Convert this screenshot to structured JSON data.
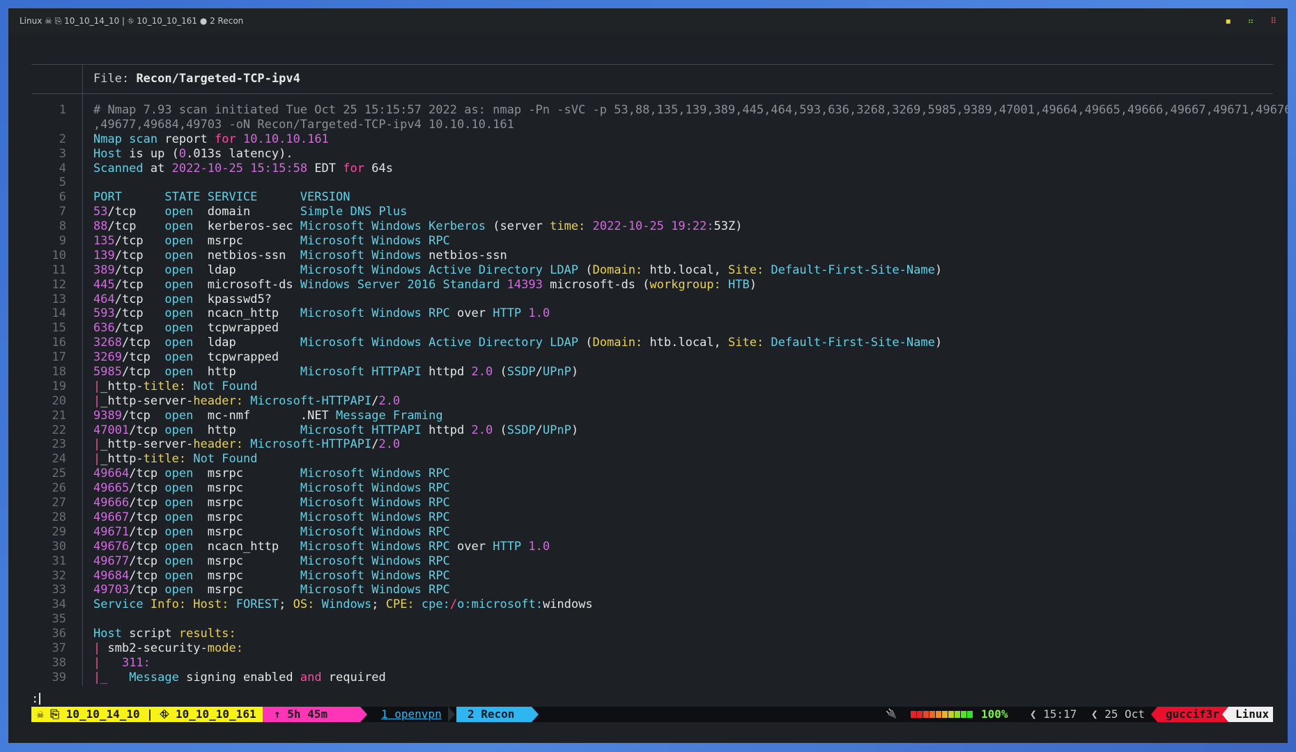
{
  "titlebar": {
    "text": "Linux ☠ ⎘ 10_10_14_10 | ⛗ 10_10_10_161 ● 2 Recon",
    "controls": [
      "▪",
      "⠶",
      "⠿"
    ]
  },
  "file_header": {
    "label": "File:",
    "filename": "Recon/Targeted-TCP-ipv4"
  },
  "lines": [
    {
      "n": "1",
      "segs": [
        [
          "cm",
          "# Nmap 7.93 scan initiated Tue Oct 25 15:15:57 2022 as: nmap -Pn -sVC -p 53,88,135,139,389,445,464,593,636,3268,3269,5985,9389,47001,49664,49665,49666,49667,49671,49676"
        ]
      ]
    },
    {
      "n": "",
      "segs": [
        [
          "cm",
          ",49677,49684,49703 -oN Recon/Targeted-TCP-ipv4 10.10.10.161"
        ]
      ]
    },
    {
      "n": "2",
      "segs": [
        [
          "k",
          "Nmap scan "
        ],
        [
          "w",
          "report "
        ],
        [
          "pk",
          "for "
        ],
        [
          "p",
          "10.10.10.161"
        ]
      ]
    },
    {
      "n": "3",
      "segs": [
        [
          "k",
          "Host "
        ],
        [
          "w",
          "is up ("
        ],
        [
          "p",
          "0"
        ],
        [
          "w",
          ".013s latency)."
        ]
      ]
    },
    {
      "n": "4",
      "segs": [
        [
          "k",
          "Scanned "
        ],
        [
          "w",
          "at "
        ],
        [
          "p",
          "2022-10-25 15:15:58 "
        ],
        [
          "w",
          "EDT "
        ],
        [
          "pk",
          "for "
        ],
        [
          "w",
          "64s"
        ]
      ]
    },
    {
      "n": "5",
      "segs": []
    },
    {
      "n": "6",
      "segs": [
        [
          "k",
          "PORT      STATE SERVICE      VERSION"
        ]
      ]
    },
    {
      "n": "7",
      "segs": [
        [
          "p",
          "53"
        ],
        [
          "w",
          "/tcp    "
        ],
        [
          "k",
          "open  "
        ],
        [
          "w",
          "domain       "
        ],
        [
          "k",
          "Simple DNS Plus"
        ]
      ]
    },
    {
      "n": "8",
      "segs": [
        [
          "p",
          "88"
        ],
        [
          "w",
          "/tcp    "
        ],
        [
          "k",
          "open  "
        ],
        [
          "w",
          "kerberos-sec "
        ],
        [
          "k",
          "Microsoft Windows Kerberos "
        ],
        [
          "w",
          "(server "
        ],
        [
          "y",
          "time: "
        ],
        [
          "p",
          "2022-10-25 19:22:"
        ],
        [
          "w",
          "53Z)"
        ]
      ]
    },
    {
      "n": "9",
      "segs": [
        [
          "p",
          "135"
        ],
        [
          "w",
          "/tcp   "
        ],
        [
          "k",
          "open  "
        ],
        [
          "w",
          "msrpc        "
        ],
        [
          "k",
          "Microsoft Windows RPC"
        ]
      ]
    },
    {
      "n": "10",
      "segs": [
        [
          "p",
          "139"
        ],
        [
          "w",
          "/tcp   "
        ],
        [
          "k",
          "open  "
        ],
        [
          "w",
          "netbios-ssn  "
        ],
        [
          "k",
          "Microsoft Windows "
        ],
        [
          "w",
          "netbios-ssn"
        ]
      ]
    },
    {
      "n": "11",
      "segs": [
        [
          "p",
          "389"
        ],
        [
          "w",
          "/tcp   "
        ],
        [
          "k",
          "open  "
        ],
        [
          "w",
          "ldap         "
        ],
        [
          "k",
          "Microsoft Windows Active Directory LDAP "
        ],
        [
          "w",
          "("
        ],
        [
          "y",
          "Domain: "
        ],
        [
          "w",
          "htb.local, "
        ],
        [
          "y",
          "Site: "
        ],
        [
          "k",
          "Default-First-Site-Name"
        ],
        [
          "w",
          ")"
        ]
      ]
    },
    {
      "n": "12",
      "segs": [
        [
          "p",
          "445"
        ],
        [
          "w",
          "/tcp   "
        ],
        [
          "k",
          "open  "
        ],
        [
          "w",
          "microsoft-ds "
        ],
        [
          "k",
          "Windows Server 2016 Standard "
        ],
        [
          "p",
          "14393 "
        ],
        [
          "w",
          "microsoft-ds ("
        ],
        [
          "y",
          "workgroup: "
        ],
        [
          "k",
          "HTB"
        ],
        [
          "w",
          ")"
        ]
      ]
    },
    {
      "n": "13",
      "segs": [
        [
          "p",
          "464"
        ],
        [
          "w",
          "/tcp   "
        ],
        [
          "k",
          "open  "
        ],
        [
          "w",
          "kpasswd5?"
        ]
      ]
    },
    {
      "n": "14",
      "segs": [
        [
          "p",
          "593"
        ],
        [
          "w",
          "/tcp   "
        ],
        [
          "k",
          "open  "
        ],
        [
          "w",
          "ncacn_http   "
        ],
        [
          "k",
          "Microsoft Windows RPC "
        ],
        [
          "w",
          "over "
        ],
        [
          "k",
          "HTTP "
        ],
        [
          "p",
          "1.0"
        ]
      ]
    },
    {
      "n": "15",
      "segs": [
        [
          "p",
          "636"
        ],
        [
          "w",
          "/tcp   "
        ],
        [
          "k",
          "open  "
        ],
        [
          "w",
          "tcpwrapped"
        ]
      ]
    },
    {
      "n": "16",
      "segs": [
        [
          "p",
          "3268"
        ],
        [
          "w",
          "/tcp  "
        ],
        [
          "k",
          "open  "
        ],
        [
          "w",
          "ldap         "
        ],
        [
          "k",
          "Microsoft Windows Active Directory LDAP "
        ],
        [
          "w",
          "("
        ],
        [
          "y",
          "Domain: "
        ],
        [
          "w",
          "htb.local, "
        ],
        [
          "y",
          "Site: "
        ],
        [
          "k",
          "Default-First-Site-Name"
        ],
        [
          "w",
          ")"
        ]
      ]
    },
    {
      "n": "17",
      "segs": [
        [
          "p",
          "3269"
        ],
        [
          "w",
          "/tcp  "
        ],
        [
          "k",
          "open  "
        ],
        [
          "w",
          "tcpwrapped"
        ]
      ]
    },
    {
      "n": "18",
      "segs": [
        [
          "p",
          "5985"
        ],
        [
          "w",
          "/tcp  "
        ],
        [
          "k",
          "open  "
        ],
        [
          "w",
          "http         "
        ],
        [
          "k",
          "Microsoft HTTPAPI "
        ],
        [
          "w",
          "httpd "
        ],
        [
          "p",
          "2.0 "
        ],
        [
          "w",
          "("
        ],
        [
          "k",
          "SSDP"
        ],
        [
          "w",
          "/"
        ],
        [
          "k",
          "UPnP"
        ],
        [
          "w",
          ")"
        ]
      ]
    },
    {
      "n": "19",
      "segs": [
        [
          "pk",
          "|"
        ],
        [
          "w",
          "_http-"
        ],
        [
          "y",
          "title: "
        ],
        [
          "k",
          "Not Found"
        ]
      ]
    },
    {
      "n": "20",
      "segs": [
        [
          "pk",
          "|"
        ],
        [
          "w",
          "_http-server-"
        ],
        [
          "y",
          "header: "
        ],
        [
          "k",
          "Microsoft-HTTPAPI"
        ],
        [
          "w",
          "/"
        ],
        [
          "p",
          "2.0"
        ]
      ]
    },
    {
      "n": "21",
      "segs": [
        [
          "p",
          "9389"
        ],
        [
          "w",
          "/tcp  "
        ],
        [
          "k",
          "open  "
        ],
        [
          "w",
          "mc-nmf       .NET "
        ],
        [
          "k",
          "Message Framing"
        ]
      ]
    },
    {
      "n": "22",
      "segs": [
        [
          "p",
          "47001"
        ],
        [
          "w",
          "/tcp "
        ],
        [
          "k",
          "open  "
        ],
        [
          "w",
          "http         "
        ],
        [
          "k",
          "Microsoft HTTPAPI "
        ],
        [
          "w",
          "httpd "
        ],
        [
          "p",
          "2.0 "
        ],
        [
          "w",
          "("
        ],
        [
          "k",
          "SSDP"
        ],
        [
          "w",
          "/"
        ],
        [
          "k",
          "UPnP"
        ],
        [
          "w",
          ")"
        ]
      ]
    },
    {
      "n": "23",
      "segs": [
        [
          "pk",
          "|"
        ],
        [
          "w",
          "_http-server-"
        ],
        [
          "y",
          "header: "
        ],
        [
          "k",
          "Microsoft-HTTPAPI"
        ],
        [
          "w",
          "/"
        ],
        [
          "p",
          "2.0"
        ]
      ]
    },
    {
      "n": "24",
      "segs": [
        [
          "pk",
          "|"
        ],
        [
          "w",
          "_http-"
        ],
        [
          "y",
          "title: "
        ],
        [
          "k",
          "Not Found"
        ]
      ]
    },
    {
      "n": "25",
      "segs": [
        [
          "p",
          "49664"
        ],
        [
          "w",
          "/tcp "
        ],
        [
          "k",
          "open  "
        ],
        [
          "w",
          "msrpc        "
        ],
        [
          "k",
          "Microsoft Windows RPC"
        ]
      ]
    },
    {
      "n": "26",
      "segs": [
        [
          "p",
          "49665"
        ],
        [
          "w",
          "/tcp "
        ],
        [
          "k",
          "open  "
        ],
        [
          "w",
          "msrpc        "
        ],
        [
          "k",
          "Microsoft Windows RPC"
        ]
      ]
    },
    {
      "n": "27",
      "segs": [
        [
          "p",
          "49666"
        ],
        [
          "w",
          "/tcp "
        ],
        [
          "k",
          "open  "
        ],
        [
          "w",
          "msrpc        "
        ],
        [
          "k",
          "Microsoft Windows RPC"
        ]
      ]
    },
    {
      "n": "28",
      "segs": [
        [
          "p",
          "49667"
        ],
        [
          "w",
          "/tcp "
        ],
        [
          "k",
          "open  "
        ],
        [
          "w",
          "msrpc        "
        ],
        [
          "k",
          "Microsoft Windows RPC"
        ]
      ]
    },
    {
      "n": "29",
      "segs": [
        [
          "p",
          "49671"
        ],
        [
          "w",
          "/tcp "
        ],
        [
          "k",
          "open  "
        ],
        [
          "w",
          "msrpc        "
        ],
        [
          "k",
          "Microsoft Windows RPC"
        ]
      ]
    },
    {
      "n": "30",
      "segs": [
        [
          "p",
          "49676"
        ],
        [
          "w",
          "/tcp "
        ],
        [
          "k",
          "open  "
        ],
        [
          "w",
          "ncacn_http   "
        ],
        [
          "k",
          "Microsoft Windows RPC "
        ],
        [
          "w",
          "over "
        ],
        [
          "k",
          "HTTP "
        ],
        [
          "p",
          "1.0"
        ]
      ]
    },
    {
      "n": "31",
      "segs": [
        [
          "p",
          "49677"
        ],
        [
          "w",
          "/tcp "
        ],
        [
          "k",
          "open  "
        ],
        [
          "w",
          "msrpc        "
        ],
        [
          "k",
          "Microsoft Windows RPC"
        ]
      ]
    },
    {
      "n": "32",
      "segs": [
        [
          "p",
          "49684"
        ],
        [
          "w",
          "/tcp "
        ],
        [
          "k",
          "open  "
        ],
        [
          "w",
          "msrpc        "
        ],
        [
          "k",
          "Microsoft Windows RPC"
        ]
      ]
    },
    {
      "n": "33",
      "segs": [
        [
          "p",
          "49703"
        ],
        [
          "w",
          "/tcp "
        ],
        [
          "k",
          "open  "
        ],
        [
          "w",
          "msrpc        "
        ],
        [
          "k",
          "Microsoft Windows RPC"
        ]
      ]
    },
    {
      "n": "34",
      "segs": [
        [
          "k",
          "Service "
        ],
        [
          "y",
          "Info: Host: "
        ],
        [
          "k",
          "FOREST"
        ],
        [
          "w",
          "; "
        ],
        [
          "y",
          "OS: "
        ],
        [
          "k",
          "Windows"
        ],
        [
          "w",
          "; "
        ],
        [
          "y",
          "CPE: "
        ],
        [
          "k",
          "cpe:"
        ],
        [
          "pk",
          "/"
        ],
        [
          "k",
          "o:microsoft:"
        ],
        [
          "w",
          "windows"
        ]
      ]
    },
    {
      "n": "35",
      "segs": []
    },
    {
      "n": "36",
      "segs": [
        [
          "k",
          "Host "
        ],
        [
          "w",
          "script "
        ],
        [
          "y",
          "results:"
        ]
      ]
    },
    {
      "n": "37",
      "segs": [
        [
          "pk",
          "| "
        ],
        [
          "w",
          "smb2-security-"
        ],
        [
          "y",
          "mode:"
        ]
      ]
    },
    {
      "n": "38",
      "segs": [
        [
          "pk",
          "|   "
        ],
        [
          "p",
          "311:"
        ]
      ]
    },
    {
      "n": "39",
      "segs": [
        [
          "pk",
          "|_   "
        ],
        [
          "k",
          "Message "
        ],
        [
          "w",
          "signing enabled "
        ],
        [
          "pk",
          "and "
        ],
        [
          "w",
          "required"
        ]
      ]
    }
  ],
  "prompt": ":",
  "statusbar": {
    "session1": "☠ ⎘ 10_10_14_10 | ⛗ 10_10_10_161",
    "uptime": "↑ 5h 45m",
    "win1": "1 openvpn",
    "win2": "2 Recon",
    "plug": "🔌",
    "battery_percent": "100%",
    "battery_level": 1.0,
    "time": "15:17",
    "date": "25 Oct",
    "user": "guccif3r",
    "os": "Linux"
  }
}
